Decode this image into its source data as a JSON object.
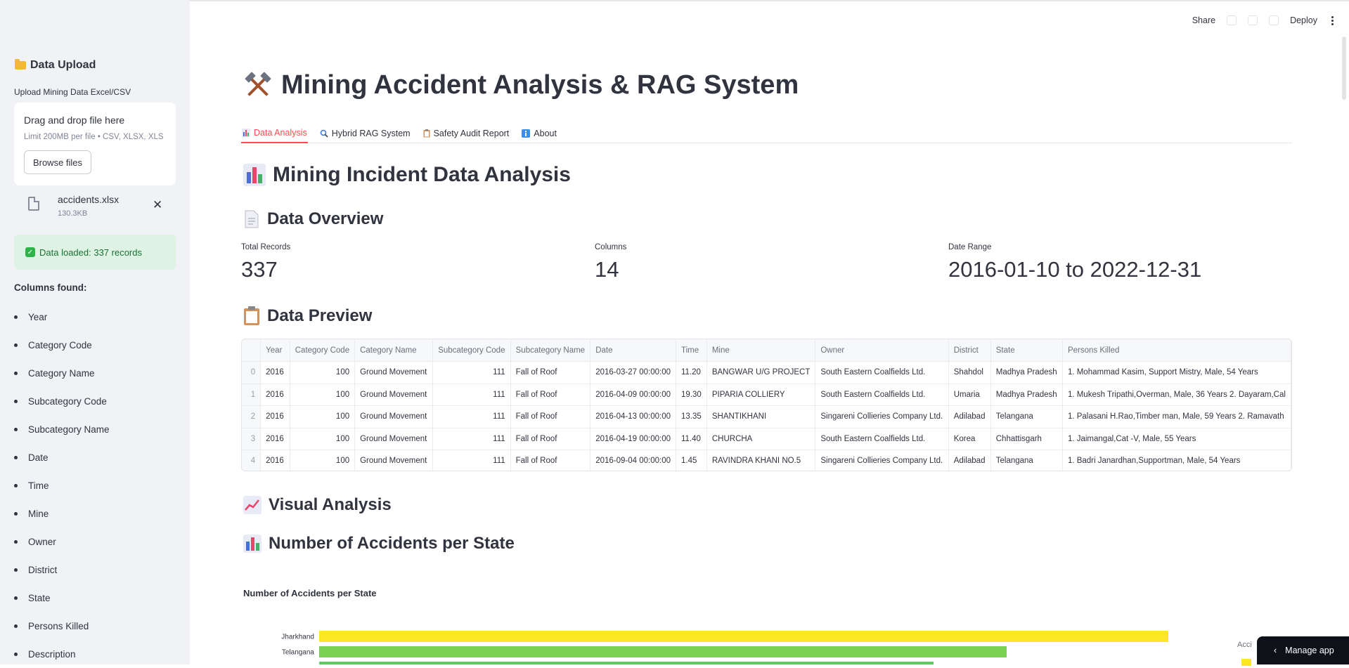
{
  "toolbar": {
    "share": "Share",
    "deploy": "Deploy"
  },
  "sidebar": {
    "heading": "Data Upload",
    "upload_label": "Upload Mining Data Excel/CSV",
    "dropzone_title": "Drag and drop file here",
    "dropzone_limit": "Limit 200MB per file • CSV, XLSX, XLS",
    "browse_label": "Browse files",
    "file_name": "accidents.xlsx",
    "file_size": "130.3KB",
    "success": "Data loaded: 337 records",
    "columns_heading": "Columns found:",
    "columns": [
      "Year",
      "Category Code",
      "Category Name",
      "Subcategory Code",
      "Subcategory Name",
      "Date",
      "Time",
      "Mine",
      "Owner",
      "District",
      "State",
      "Persons Killed",
      "Description"
    ]
  },
  "main": {
    "title": "Mining Accident Analysis & RAG System",
    "tabs": [
      {
        "label": "Data Analysis",
        "icon": "bar-chart-icon"
      },
      {
        "label": "Hybrid RAG System",
        "icon": "magnifier-icon"
      },
      {
        "label": "Safety Audit Report",
        "icon": "clipboard-icon"
      },
      {
        "label": "About",
        "icon": "info-icon"
      }
    ],
    "section_title": "Mining Incident Data Analysis",
    "overview_title": "Data Overview",
    "metrics": [
      {
        "label": "Total Records",
        "value": "337"
      },
      {
        "label": "Columns",
        "value": "14"
      },
      {
        "label": "Date Range",
        "value": "2016-01-10 to 2022-12-31"
      }
    ],
    "preview_title": "Data Preview",
    "table": {
      "headers": [
        "",
        "Year",
        "Category Code",
        "Category Name",
        "Subcategory Code",
        "Subcategory Name",
        "Date",
        "Time",
        "Mine",
        "Owner",
        "District",
        "State",
        "Persons Killed"
      ],
      "rows": [
        [
          "0",
          "2016",
          "100",
          "Ground Movement",
          "111",
          "Fall of Roof",
          "2016-03-27 00:00:00",
          "11.20",
          "BANGWAR U/G PROJECT",
          "South Eastern Coalfields Ltd.",
          "Shahdol",
          "Madhya Pradesh",
          "1. Mohammad Kasim, Support Mistry, Male, 54 Years"
        ],
        [
          "1",
          "2016",
          "100",
          "Ground Movement",
          "111",
          "Fall of Roof",
          "2016-04-09 00:00:00",
          "19.30",
          "PIPARIA COLLIERY",
          "South Eastern Coalfields Ltd.",
          "Umaria",
          "Madhya Pradesh",
          "1. Mukesh Tripathi,Overman, Male, 36 Years 2. Dayaram,Cal"
        ],
        [
          "2",
          "2016",
          "100",
          "Ground Movement",
          "111",
          "Fall of Roof",
          "2016-04-13 00:00:00",
          "13.35",
          "SHANTIKHANI",
          "Singareni Collieries Company Ltd.",
          "Adilabad",
          "Telangana",
          "1. Palasani H.Rao,Timber man, Male, 59 Years 2. Ramavath"
        ],
        [
          "3",
          "2016",
          "100",
          "Ground Movement",
          "111",
          "Fall of Roof",
          "2016-04-19 00:00:00",
          "11.40",
          "CHURCHA",
          "South Eastern Coalfields Ltd.",
          "Korea",
          "Chhattisgarh",
          "1. Jaimangal,Cat -V, Male, 55 Years"
        ],
        [
          "4",
          "2016",
          "100",
          "Ground Movement",
          "111",
          "Fall of Roof",
          "2016-09-04 00:00:00",
          "1.45",
          "RAVINDRA KHANI NO.5",
          "Singareni Collieries Company Ltd.",
          "Adilabad",
          "Telangana",
          "1. Badri Janardhan,Supportman, Male, 54 Years"
        ]
      ]
    },
    "visual_title": "Visual Analysis",
    "chart_section_title": "Number of Accidents per State",
    "legend_stub": "Acci"
  },
  "chart_data": {
    "type": "bar",
    "orientation": "horizontal",
    "title": "Number of Accidents per State",
    "categories": [
      "Jharkhand",
      "Telangana",
      ""
    ],
    "values": [
      105,
      85,
      76
    ],
    "colors": [
      "#fde725",
      "#7ad151",
      "#5ec962"
    ],
    "xlim": [
      0,
      120
    ]
  },
  "manage_app": "Manage app"
}
